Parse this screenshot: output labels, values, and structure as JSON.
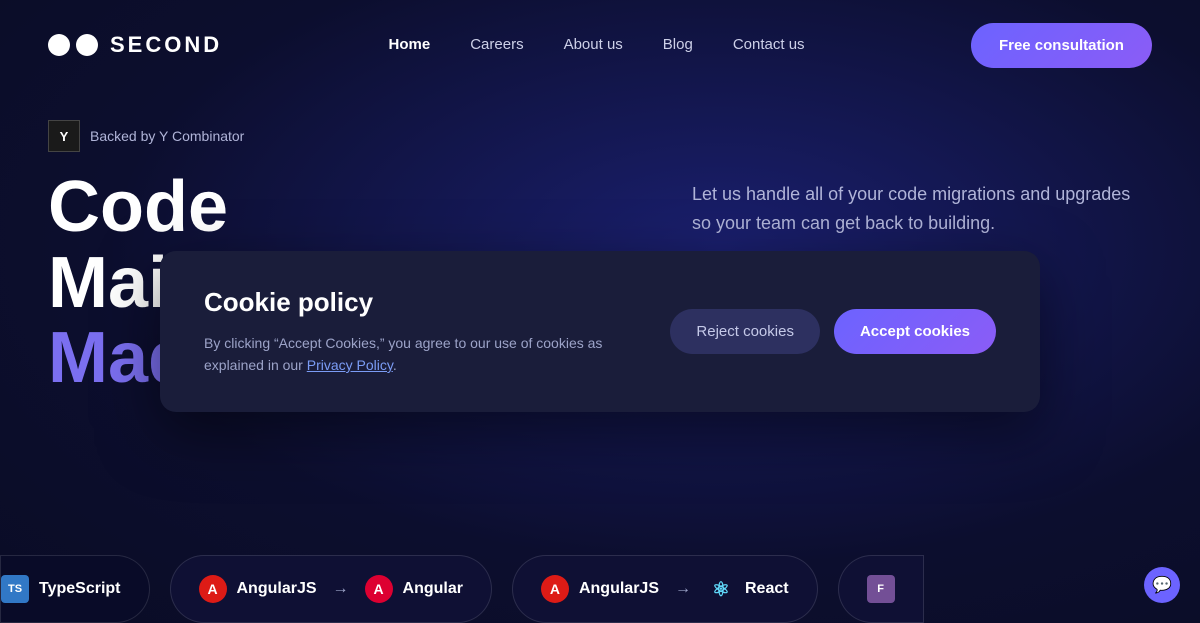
{
  "brand": {
    "name": "SECOND",
    "dots_count": 2
  },
  "nav": {
    "links": [
      {
        "label": "Home",
        "active": true
      },
      {
        "label": "Careers",
        "active": false
      },
      {
        "label": "About us",
        "active": false
      },
      {
        "label": "Blog",
        "active": false
      },
      {
        "label": "Contact us",
        "active": false
      }
    ],
    "cta": "Free consultation"
  },
  "hero": {
    "badge": {
      "logo": "Y",
      "text": "Backed by Y Combinator"
    },
    "title_line1": "Code Maintenance",
    "title_line2": "Made",
    "description": "Let us handle all of your code migrations and upgrades so your team can get back to building."
  },
  "cookie": {
    "title": "Cookie policy",
    "description": "By clicking “Accept Cookies,” you agree to our use of cookies as explained in our ",
    "privacy_link": "Privacy Policy",
    "period": ".",
    "reject_label": "Reject cookies",
    "accept_label": "Accept cookies"
  },
  "tech_strip": [
    {
      "icon_type": "ts",
      "icon_label": "TS",
      "label": "TypeScript",
      "arrow": null,
      "target": null
    },
    {
      "icon_type": "angular",
      "icon_label": "A",
      "label": "AngularJS",
      "arrow": "→",
      "target_icon": "angular",
      "target_label": "Angular"
    },
    {
      "icon_type": "angular",
      "icon_label": "A",
      "label": "AngularJS",
      "arrow": "→",
      "target_icon": "react",
      "target_label": "React"
    },
    {
      "icon_type": "fortran",
      "icon_label": "F",
      "label": "",
      "arrow": null,
      "target": null
    }
  ]
}
